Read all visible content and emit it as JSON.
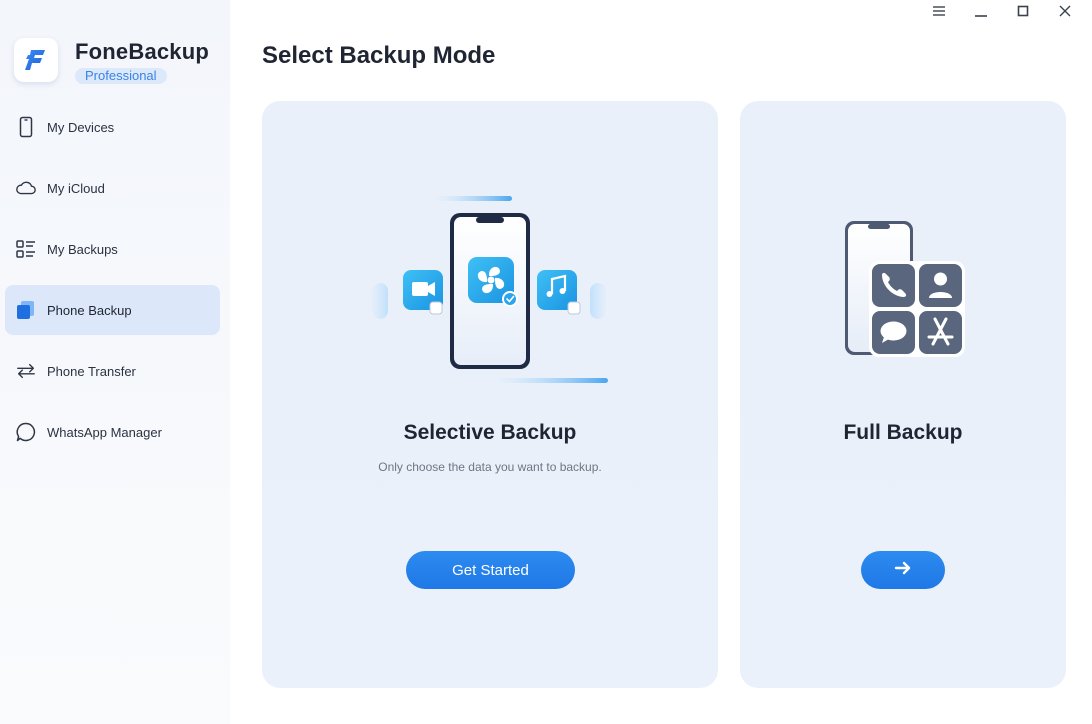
{
  "app": {
    "name": "FoneBackup",
    "edition": "Professional"
  },
  "window_controls": [
    {
      "icon": "menu-icon"
    },
    {
      "icon": "minimize-icon"
    },
    {
      "icon": "maximize-icon"
    },
    {
      "icon": "close-icon"
    }
  ],
  "sidebar": {
    "items": [
      {
        "label": "My Devices",
        "icon": "phone-outline-icon",
        "active": false
      },
      {
        "label": "My iCloud",
        "icon": "cloud-icon",
        "active": false
      },
      {
        "label": "My Backups",
        "icon": "backups-list-icon",
        "active": false
      },
      {
        "label": "Phone Backup",
        "icon": "phone-backup-icon",
        "active": true
      },
      {
        "label": "Phone Transfer",
        "icon": "transfer-arrows-icon",
        "active": false
      },
      {
        "label": "WhatsApp Manager",
        "icon": "chat-bubble-icon",
        "active": false
      }
    ]
  },
  "main": {
    "title": "Select Backup Mode",
    "cards": [
      {
        "title": "Selective Backup",
        "description": "Only choose the data you want to backup.",
        "button_label": "Get Started",
        "illustration": "selective-backup-illustration"
      },
      {
        "title": "Full Backup",
        "description": "",
        "button_icon": "arrow-right-icon",
        "illustration": "full-backup-illustration"
      }
    ]
  },
  "colors": {
    "accent": "#1f78e6",
    "active_nav_bg": "#dce8f9",
    "card_bg": "#eaf0fa",
    "edition_badge_bg": "#dce9fb",
    "edition_badge_text": "#3a82e6",
    "icon_slate": "#5a667d",
    "app_icon_blue": "#23a6e8"
  }
}
